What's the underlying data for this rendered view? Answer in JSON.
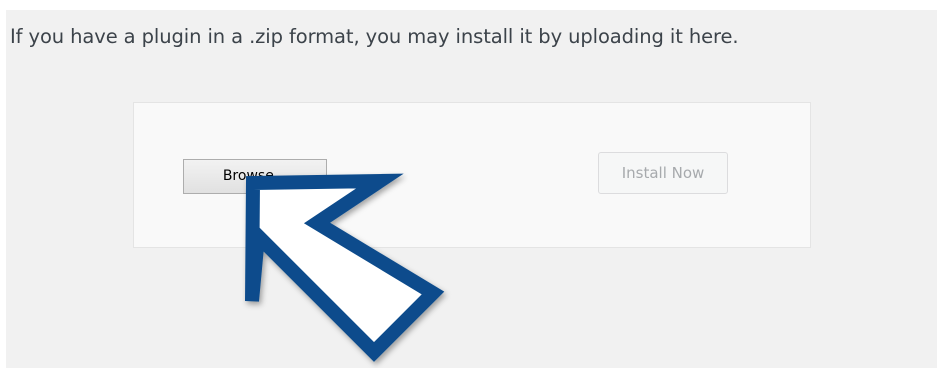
{
  "upload": {
    "description": "If you have a plugin in a .zip format, you may install it by uploading it here.",
    "browse_label": "Browse...",
    "install_label": "Install Now"
  },
  "annotation": {
    "icon": "pointer-arrow-icon",
    "color": "#0b4c8c"
  }
}
